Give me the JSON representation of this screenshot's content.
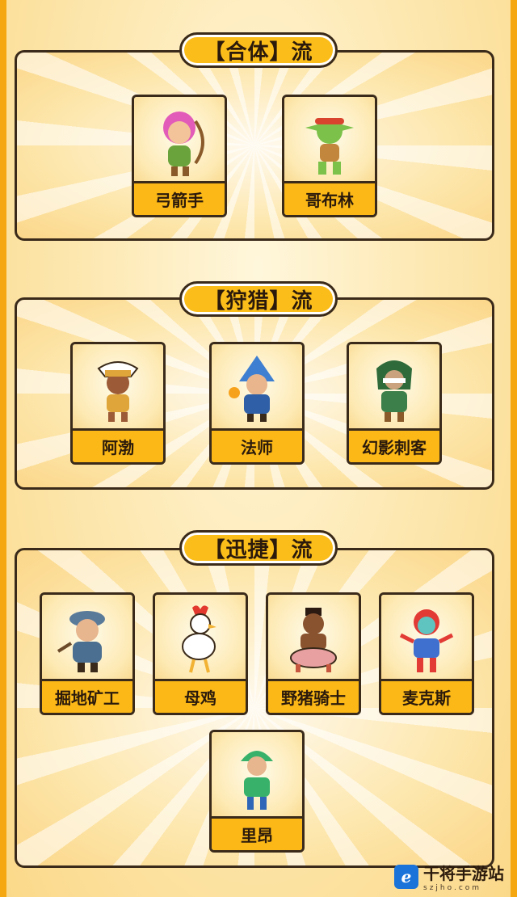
{
  "sections": [
    {
      "title": "【合体】流",
      "cards": [
        {
          "name": "弓箭手",
          "icon": "archer-icon",
          "hair": "#e25bb8",
          "skin": "#f3c49a",
          "cloth": "#6aa33b"
        },
        {
          "name": "哥布林",
          "icon": "goblin-icon",
          "hair": "#d9442f",
          "skin": "#7cc24a",
          "cloth": "#c2863d"
        }
      ]
    },
    {
      "title": "【狩猎】流",
      "cards": [
        {
          "name": "阿渤",
          "icon": "bo-icon",
          "hair": "#ffffff",
          "skin": "#9c5a36",
          "cloth": "#e0a53a"
        },
        {
          "name": "法师",
          "icon": "wizard-icon",
          "hair": "#3f7fd1",
          "skin": "#e9b58c",
          "cloth": "#2f5fa6"
        },
        {
          "name": "幻影刺客",
          "icon": "phantom-assassin-icon",
          "hair": "#2f6b3a",
          "skin": "#caa27d",
          "cloth": "#3d7f4a"
        }
      ]
    },
    {
      "title": "【迅捷】流",
      "cards": [
        {
          "name": "掘地矿工",
          "icon": "miner-icon",
          "hair": "#5a7a9a",
          "skin": "#e7b58e",
          "cloth": "#4a6f90"
        },
        {
          "name": "母鸡",
          "icon": "hen-icon",
          "hair": "#e2382d",
          "skin": "#ffffff",
          "cloth": "#f2b234"
        },
        {
          "name": "野猪骑士",
          "icon": "hog-rider-icon",
          "hair": "#2a1a12",
          "skin": "#8a5330",
          "cloth": "#c6563d"
        },
        {
          "name": "麦克斯",
          "icon": "max-icon",
          "hair": "#e23a34",
          "skin": "#5fc4c0",
          "cloth": "#3f6fcf"
        },
        {
          "name": "里昂",
          "icon": "leon-icon",
          "hair": "#38b26a",
          "skin": "#e7b58e",
          "cloth": "#2f66b8"
        }
      ]
    }
  ],
  "watermark": {
    "title": "干将手游站",
    "sub": "szjho.com",
    "logo": "ℯ"
  }
}
